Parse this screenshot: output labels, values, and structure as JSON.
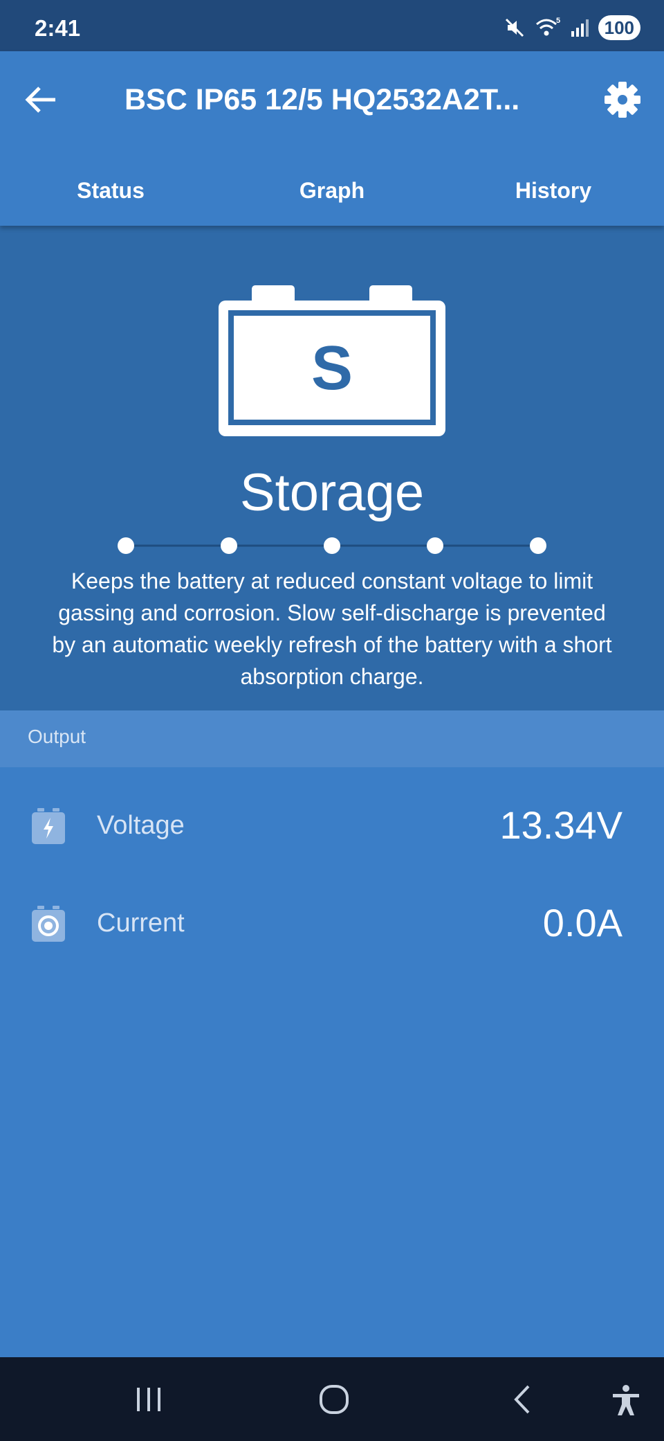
{
  "status_bar": {
    "time": "2:41",
    "wifi_badge": "5",
    "battery": "100",
    "icons": [
      "mute-icon",
      "wifi-icon",
      "signal-icon"
    ]
  },
  "app_bar": {
    "title": "BSC IP65 12/5 HQ2532A2T...",
    "back_icon": "arrow-left-icon",
    "settings_icon": "gear-icon"
  },
  "tabs": [
    {
      "label": "Status"
    },
    {
      "label": "Graph"
    },
    {
      "label": "History"
    }
  ],
  "charge_state": {
    "letter": "S",
    "name": "Storage",
    "steps": 5,
    "description": "Keeps the battery at reduced constant voltage to limit gassing and corrosion. Slow self-discharge is prevented by an automatic weekly refresh of the battery with a short absorption charge."
  },
  "output": {
    "section_label": "Output",
    "rows": [
      {
        "label": "Voltage",
        "value": "13.34V",
        "icon": "voltage-icon"
      },
      {
        "label": "Current",
        "value": "0.0A",
        "icon": "current-icon"
      }
    ]
  },
  "colors": {
    "status_bar": "#21497a",
    "app_bar": "#3b7ec7",
    "hero": "#2f6aa8",
    "section_header": "#4d89cc",
    "content": "#3b7ec7",
    "nav_bar": "#0f1829"
  },
  "nav_bar": {
    "icons": [
      "recent-apps-icon",
      "home-icon",
      "back-icon",
      "accessibility-icon"
    ]
  }
}
